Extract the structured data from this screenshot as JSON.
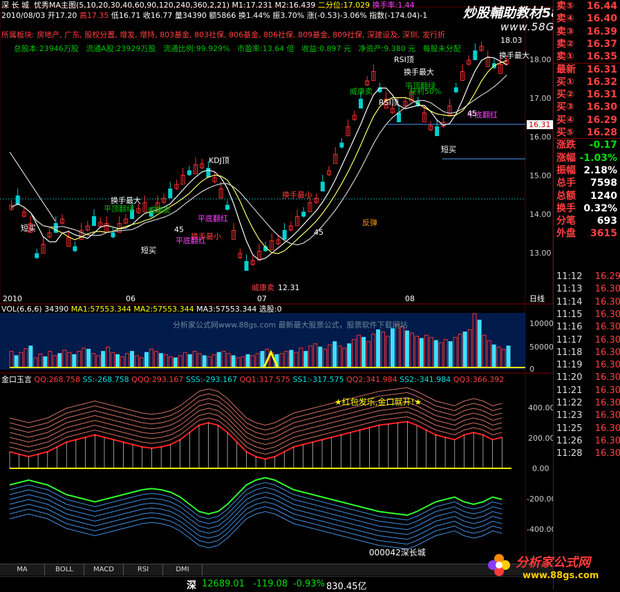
{
  "header": {
    "line1": {
      "stock": "深 长 城",
      "indicator": "忧秀MA主图(5,10,20,30,40,60,90,120,240,360,2,21)",
      "m1": "M1:17.231",
      "m2": "M2:16.439",
      "quartile": "二分位:17.029",
      "turnover": "换手率:1.44"
    },
    "line2": {
      "date": "2010/08/03",
      "open": "开17.20",
      "high": "高17.35",
      "low": "低16.71",
      "close": "收16.77",
      "vol": "量34390",
      "amount": "额5866",
      "turn": "换1.44%",
      "amp": "振3.70%",
      "change": "涨(-0.53)-3.06%",
      "index": "指数(-174.04)-1"
    },
    "line3": "所属板块: 房地产, 广东, 股权分置, 增发, 增持, 803基金, 803社保, 806基金, 806社保, 809基金, 809社保, 深建设及, 深圳, 发行折",
    "line4": {
      "total_shares": "总股本:23946万股",
      "float_a": "流通A股:23929万股",
      "float_ratio": "流通比例:99.929%",
      "pe": "市盈率:13.64 倍",
      "eps": "收益:0.897 元",
      "nav": "净资产:9.380 元",
      "extra": "每股未分配"
    }
  },
  "watermark": {
    "title": "炒股輔助教材58股网",
    "url": "www.58Gu.com"
  },
  "price_axis": [
    "18.00",
    "17.00",
    "16.00",
    "15.00",
    "14.00",
    "13.00"
  ],
  "last_price_tag": "16.31",
  "x_axis": [
    "2010",
    "06",
    "07",
    "08"
  ],
  "period_label": "日线",
  "annotations": {
    "rsi_top1": "RSI顶",
    "rsi_top2": "RSI顶",
    "kdj_top": "KDJ顶",
    "huanshou_max1": "换手最大",
    "huanshou_max2": "换手最大",
    "huanshou_max3": "换手最大",
    "huanshou_min1": "换手最小",
    "huanshou_min2": "换手最小",
    "pingding": "平顶翻绿",
    "pingding2": "平顶翻绿",
    "pingdi1": "平底翻红",
    "pingdi2": "平底翻红",
    "pingdi3": "平底翻红",
    "weikang": "威康卖",
    "weikang2": "威康卖",
    "weikang3": "威康卖",
    "duanmai1": "短买",
    "duanmai2": "短买",
    "duanmai3": "短买",
    "fantan": "反弹",
    "jianxiao": "获利50%",
    "low_price": "12.31",
    "top_price": "18.03",
    "val45a": "45",
    "val45b": "45",
    "val45c": "45"
  },
  "volume": {
    "params": "VOL(6,6,6)",
    "vol": "34390",
    "ma1": "MA1:57553.344",
    "ma2": "MA2:57553.344",
    "ma3": "MA3:57553.344",
    "sel": "选股:0",
    "banner": "分析家公式网www.88gs.com 最新最大股票公式，股票软件下载网站",
    "axis": [
      "100000",
      "50000",
      "0"
    ],
    "bars": [
      30,
      22,
      28,
      35,
      40,
      18,
      25,
      20,
      30,
      22,
      26,
      32,
      28,
      24,
      30,
      36,
      34,
      26,
      22,
      30,
      38,
      28,
      24,
      20,
      26,
      30,
      22,
      18,
      28,
      34,
      30,
      26,
      24,
      20,
      18,
      22,
      28,
      24,
      30,
      26,
      22,
      20,
      24,
      28,
      30,
      26,
      22,
      18,
      20,
      24,
      22,
      26,
      30,
      34,
      28,
      24,
      26,
      30,
      32,
      28,
      36,
      30,
      40,
      44,
      38,
      34,
      42,
      48,
      40,
      36,
      44,
      52,
      60,
      56,
      48,
      62,
      70,
      66,
      58,
      72,
      80,
      76,
      68,
      64,
      58,
      54,
      60,
      56,
      50,
      46,
      52,
      48,
      56,
      62,
      66,
      70,
      100,
      88,
      60,
      50,
      42,
      38,
      34,
      40
    ]
  },
  "jinkou": {
    "name": "金口玉言",
    "qq": "QQ:268.758",
    "ss": "SS:-268.758",
    "qqq": "QQQ:293.167",
    "sss": "SSS:-293.167",
    "qq1": "QQ1:317.575",
    "ss1": "SS1:-317.575",
    "qq2": "QQ2:341.984",
    "ss2": "SS2:-341.984",
    "qq3": "QQ3:366.392",
    "slogan": "★红包发乐,金口就开!★",
    "stockcode": "000042深长城",
    "axis": [
      "400.00",
      "200.00",
      "0.00",
      "-200.00",
      "-400.00"
    ]
  },
  "quotes": [
    {
      "label": "卖⑤",
      "value": "16.44",
      "lcolor": "#ff4040",
      "vcolor": "#ff4040"
    },
    {
      "label": "卖④",
      "value": "16.40",
      "lcolor": "#ff4040",
      "vcolor": "#ff4040"
    },
    {
      "label": "卖③",
      "value": "16.39",
      "lcolor": "#ff4040",
      "vcolor": "#ff4040"
    },
    {
      "label": "卖②",
      "value": "16.37",
      "lcolor": "#ff4040",
      "vcolor": "#ff4040"
    },
    {
      "label": "卖①",
      "value": "16.35",
      "lcolor": "#ff4040",
      "vcolor": "#ff4040"
    },
    {
      "label": "最新",
      "value": "16.31",
      "lcolor": "#ff4040",
      "vcolor": "#ff4040"
    },
    {
      "label": "买①",
      "value": "16.32",
      "lcolor": "#ff4040",
      "vcolor": "#ff4040"
    },
    {
      "label": "买②",
      "value": "16.31",
      "lcolor": "#ff4040",
      "vcolor": "#ff4040"
    },
    {
      "label": "买③",
      "value": "16.30",
      "lcolor": "#ff4040",
      "vcolor": "#ff4040"
    },
    {
      "label": "买④",
      "value": "16.29",
      "lcolor": "#ff4040",
      "vcolor": "#ff4040"
    },
    {
      "label": "买⑤",
      "value": "16.28",
      "lcolor": "#ff4040",
      "vcolor": "#ff4040"
    },
    {
      "label": "涨跌",
      "value": "-0.17",
      "lcolor": "#ff4040",
      "vcolor": "#00e000"
    },
    {
      "label": "涨幅",
      "value": "-1.03%",
      "lcolor": "#ff4040",
      "vcolor": "#00e000"
    },
    {
      "label": "振幅",
      "value": "2.18%",
      "lcolor": "#ff4040",
      "vcolor": "#ffffff"
    },
    {
      "label": "总手",
      "value": "7598",
      "lcolor": "#ff4040",
      "vcolor": "#ffffff"
    },
    {
      "label": "总额",
      "value": "1240",
      "lcolor": "#ff4040",
      "vcolor": "#ffffff"
    },
    {
      "label": "换手",
      "value": "0.32%",
      "lcolor": "#ff4040",
      "vcolor": "#ffffff"
    },
    {
      "label": "分笔",
      "value": "693",
      "lcolor": "#ff4040",
      "vcolor": "#ffffff"
    },
    {
      "label": "外盘",
      "value": "3615",
      "lcolor": "#ff4040",
      "vcolor": "#ff4040"
    }
  ],
  "ticks": [
    {
      "time": "11:12",
      "price": "16.29"
    },
    {
      "time": "11:13",
      "price": "16.30"
    },
    {
      "time": "11:14",
      "price": "16.30"
    },
    {
      "time": "11:15",
      "price": "16.30"
    },
    {
      "time": "11:16",
      "price": "16.30"
    },
    {
      "time": "11:17",
      "price": "16.30"
    },
    {
      "time": "11:18",
      "price": "16.30"
    },
    {
      "time": "11:19",
      "price": "16.30"
    },
    {
      "time": "11:20",
      "price": "16.30"
    },
    {
      "time": "11:21",
      "price": "16.30"
    },
    {
      "time": "11:22",
      "price": "16.30"
    },
    {
      "time": "11:23",
      "price": "16.30"
    },
    {
      "time": "11:25",
      "price": "16.30"
    },
    {
      "time": "11:26",
      "price": "16.30"
    },
    {
      "time": "11:28",
      "price": "16.30"
    }
  ],
  "bottom_tabs": [
    "MA",
    "BOLL",
    "MACD",
    "RSI",
    "DMI"
  ],
  "status": {
    "market": "深",
    "index": "12689.01",
    "change": "-119.08",
    "pct": "-0.93%",
    "amount": "830.45亿"
  },
  "logo": {
    "title": "分析家公式网",
    "url": "www.88gs.com"
  }
}
